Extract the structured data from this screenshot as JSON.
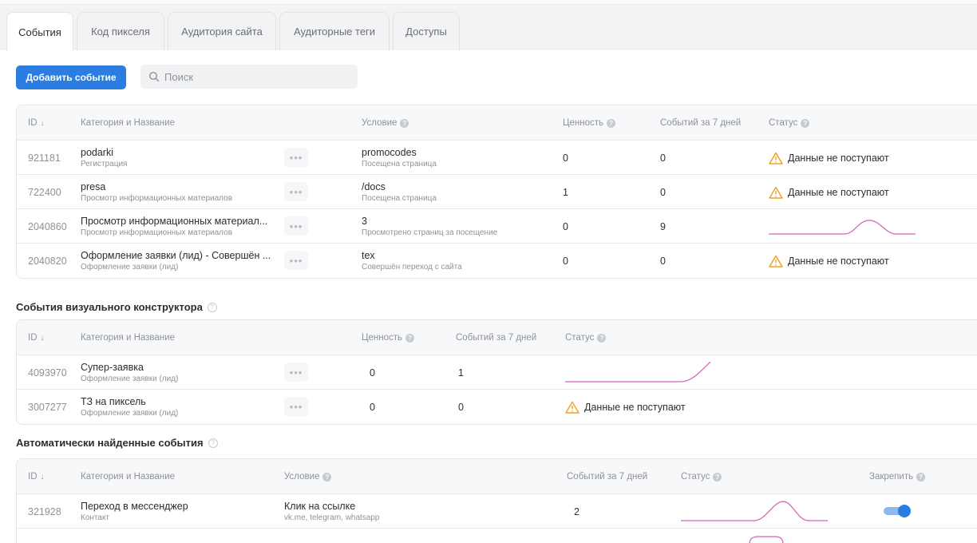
{
  "tabs": [
    {
      "label": "События"
    },
    {
      "label": "Код пикселя"
    },
    {
      "label": "Аудитория сайта"
    },
    {
      "label": "Аудиторные теги"
    },
    {
      "label": "Доступы"
    }
  ],
  "toolbar": {
    "add_label": "Добавить событие",
    "search_placeholder": "Поиск"
  },
  "events": {
    "headers": {
      "id": "ID",
      "name": "Категория и Название",
      "condition": "Условие",
      "value": "Ценность",
      "count": "Событий за 7 дней",
      "status": "Статус"
    },
    "rows": [
      {
        "id": "921181",
        "name": "podarki",
        "category": "Регистрация",
        "condition": "promocodes",
        "condition_type": "Посещена страница",
        "value": "0",
        "count": "0",
        "status": "Данные не поступают",
        "has_data": false
      },
      {
        "id": "722400",
        "name": "presa",
        "category": "Просмотр информационных материалов",
        "condition": "/docs",
        "condition_type": "Посещена страница",
        "value": "1",
        "count": "0",
        "status": "Данные не поступают",
        "has_data": false
      },
      {
        "id": "2040860",
        "name": "Просмотр информационных материал...",
        "category": "Просмотр информационных материалов",
        "condition": "3",
        "condition_type": "Просмотрено страниц за посещение",
        "value": "0",
        "count": "9",
        "status": "",
        "has_data": true
      },
      {
        "id": "2040820",
        "name": "Оформление заявки (лид) - Совершён ...",
        "category": "Оформление заявки (лид)",
        "condition": "tex",
        "condition_type": "Совершён переход с сайта",
        "value": "0",
        "count": "0",
        "status": "Данные не поступают",
        "has_data": false
      }
    ]
  },
  "visual": {
    "title": "События визуального конструктора",
    "headers": {
      "id": "ID",
      "name": "Категория и Название",
      "value": "Ценность",
      "count": "Событий за 7 дней",
      "status": "Статус"
    },
    "rows": [
      {
        "id": "4093970",
        "name": "Супер-заявка",
        "category": "Оформление заявки (лид)",
        "value": "0",
        "count": "1",
        "status": "",
        "has_data": true
      },
      {
        "id": "3007277",
        "name": "ТЗ на пиксель",
        "category": "Оформление заявки (лид)",
        "value": "0",
        "count": "0",
        "status": "Данные не поступают",
        "has_data": false
      }
    ]
  },
  "auto": {
    "title": "Автоматически найденные события",
    "headers": {
      "id": "ID",
      "name": "Категория и Название",
      "condition": "Условие",
      "count": "Событий за 7 дней",
      "status": "Статус",
      "pin": "Закрепить"
    },
    "rows": [
      {
        "id": "321928",
        "name": "Переход в мессенджер",
        "category": "Контакт",
        "condition": "Клик на ссылке",
        "condition_detail": "vk.me, telegram, whatsapp",
        "count": "2",
        "status": "",
        "has_data": true,
        "pinned": true
      }
    ]
  },
  "colors": {
    "accent": "#2b7de1",
    "warning": "#f0a020",
    "sparkline": "#d064b4"
  },
  "icons": {
    "search": "search-icon",
    "warning": "warning-icon",
    "help": "question-icon",
    "more": "more-dots-icon"
  }
}
